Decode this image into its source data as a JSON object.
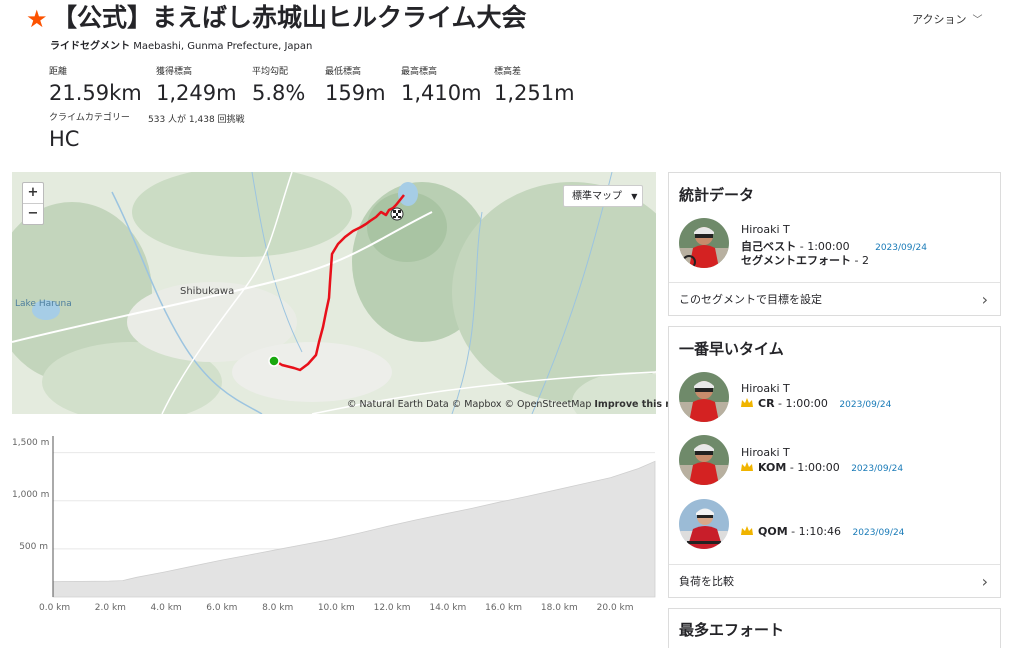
{
  "header": {
    "title": "【公式】まえばし赤城山ヒルクライム大会",
    "segment_type": "ライドセグメント",
    "location": "Maebashi, Gunma Prefecture, Japan",
    "action_label": "アクション"
  },
  "stats": [
    {
      "label": "距離",
      "value": "21.59km"
    },
    {
      "label": "獲得標高",
      "value": "1,249m"
    },
    {
      "label": "平均勾配",
      "value": "5.8%"
    },
    {
      "label": "最低標高",
      "value": "159m"
    },
    {
      "label": "最高標高",
      "value": "1,410m"
    },
    {
      "label": "標高差",
      "value": "1,251m"
    }
  ],
  "climb": {
    "label": "クライムカテゴリー",
    "value": "HC",
    "attempts": "533 人が 1,438 回挑戦"
  },
  "map": {
    "zoom_in": "+",
    "zoom_out": "−",
    "map_type": "標準マップ",
    "place_shibukawa": "Shibukawa",
    "place_lake": "Lake Haruna",
    "attribution_prefix": "© Natural Earth Data © Mapbox © OpenStreetMap",
    "attribution_link": "Improve this map",
    "route_color": "#e8101a",
    "start_color": "#19a80f"
  },
  "elevation": {
    "y_ticks": [
      "1,500 m",
      "1,000 m",
      "500 m"
    ],
    "x_ticks": [
      "0.0 km",
      "2.0 km",
      "4.0 km",
      "6.0 km",
      "8.0 km",
      "10.0 km",
      "12.0 km",
      "14.0 km",
      "16.0 km",
      "18.0 km",
      "20.0 km"
    ]
  },
  "chart_data": {
    "type": "area",
    "xlabel": "",
    "ylabel": "",
    "x_unit": "km",
    "y_unit": "m",
    "xlim": [
      0,
      21.59
    ],
    "ylim": [
      0,
      1600
    ],
    "grid": true,
    "x": [
      0,
      1,
      2,
      2.5,
      3,
      4,
      5,
      6,
      7,
      8,
      9,
      10,
      11,
      12,
      13,
      14,
      15,
      16,
      17,
      18,
      19,
      20,
      21,
      21.59
    ],
    "y": [
      159,
      162,
      165,
      170,
      205,
      260,
      320,
      380,
      435,
      490,
      545,
      600,
      665,
      735,
      800,
      860,
      920,
      985,
      1045,
      1110,
      1175,
      1240,
      1335,
      1410
    ]
  },
  "stats_panel": {
    "title": "統計データ",
    "athlete": "Hiroaki T",
    "pr_label": "自己ベスト",
    "pr_value": "- 1:00:00",
    "pr_date": "2023/09/24",
    "efforts_label": "セグメントエフォート",
    "efforts_value": "- 2",
    "goal_link": "このセグメントで目標を設定"
  },
  "fastest_panel": {
    "title": "一番早いタイム",
    "entries": [
      {
        "name": "Hiroaki T",
        "badge": "CR",
        "time": "- 1:00:00",
        "date": "2023/09/24"
      },
      {
        "name": "Hiroaki T",
        "badge": "KOM",
        "time": "- 1:00:00",
        "date": "2023/09/24"
      },
      {
        "name": "",
        "badge": "QOM",
        "time": "- 1:10:46",
        "date": "2023/09/24"
      }
    ],
    "compare_link": "負荷を比較"
  },
  "most_panel": {
    "title": "最多エフォート"
  }
}
